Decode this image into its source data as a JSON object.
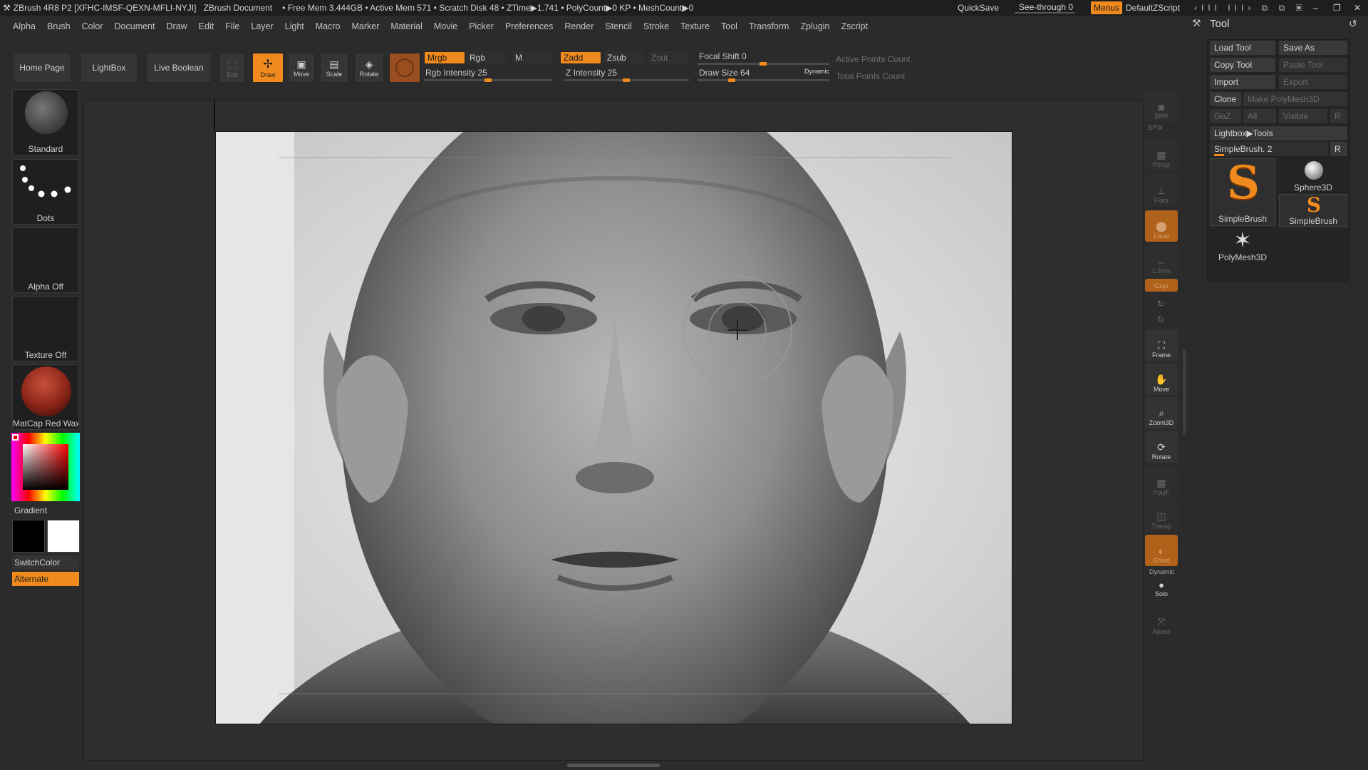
{
  "titlebar": {
    "app": "ZBrush 4R8 P2 [XFHC-IMSF-QEXN-MFLI-NYJI]",
    "document": "ZBrush Document",
    "stats": "• Free Mem 3.444GB • Active Mem 571 • Scratch Disk 48 • ZTime▶1.741 • PolyCount▶0 KP • MeshCount▶0",
    "quicksave": "QuickSave",
    "see_through": "See-through  0",
    "menus": "Menus",
    "script": "DefaultZScript"
  },
  "menubar": [
    "Alpha",
    "Brush",
    "Color",
    "Document",
    "Draw",
    "Edit",
    "File",
    "Layer",
    "Light",
    "Macro",
    "Marker",
    "Material",
    "Movie",
    "Picker",
    "Preferences",
    "Render",
    "Stencil",
    "Stroke",
    "Texture",
    "Tool",
    "Transform",
    "Zplugin",
    "Zscript"
  ],
  "topbar": {
    "home_page": "Home Page",
    "lightbox": "LightBox",
    "live_boolean": "Live Boolean",
    "edit": "Edit",
    "draw": "Draw",
    "move": "Move",
    "scale": "Scale",
    "rotate": "Rotate",
    "mrgb": "Mrgb",
    "rgb": "Rgb",
    "m": "M",
    "zadd": "Zadd",
    "zsub": "Zsub",
    "zcut": "Zcut",
    "rgb_intensity": "Rgb Intensity 25",
    "z_intensity": "Z Intensity 25",
    "focal_shift": "Focal Shift 0",
    "draw_size": "Draw Size 64",
    "dynamic": "Dynamic",
    "active_points": "Active Points Count",
    "total_points": "Total Points Count",
    "rgb_intensity_value": 25,
    "z_intensity_value": 25,
    "focal_shift_value": 0,
    "draw_size_value": 64
  },
  "leftpanel": {
    "brush": "Standard",
    "stroke": "Dots",
    "alpha": "Alpha Off",
    "texture": "Texture Off",
    "material": "MatCap Red Wax",
    "gradient": "Gradient",
    "switchcolor": "SwitchColor",
    "alternate": "Alternate"
  },
  "rightshelf": {
    "bpr": "BPR",
    "spix": "SPix",
    "persp": "Persp",
    "floor": "Floor",
    "local": "Local",
    "lsym": "L.Sym",
    "xyz": "Gxyz",
    "frame": "Frame",
    "move": "Move",
    "zoom3d": "Zoom3D",
    "rotate": "Rotate",
    "polyf": "PolyF",
    "transp": "Transp",
    "ghost": "Ghost",
    "dynamic": "Dynamic",
    "solo": "Solo",
    "xpose": "Xpose"
  },
  "toolpanel": {
    "title": "Tool",
    "load_tool": "Load Tool",
    "save_as": "Save As",
    "copy_tool": "Copy Tool",
    "paste_tool": "Paste Tool",
    "import": "Import",
    "export": "Export",
    "clone": "Clone",
    "make_polymesh": "Make PolyMesh3D",
    "goz": "GoZ",
    "all": "All",
    "visible": "Visible",
    "r": "R",
    "lightbox_tools": "Lightbox▶Tools",
    "current_tool": "SimpleBrush. 2",
    "tools": [
      "SimpleBrush",
      "Sphere3D",
      "SimpleBrush",
      "PolyMesh3D"
    ]
  },
  "colors": {
    "accent": "#f08a1c",
    "panel": "#2b2b2b",
    "dark": "#1e1e1e"
  }
}
